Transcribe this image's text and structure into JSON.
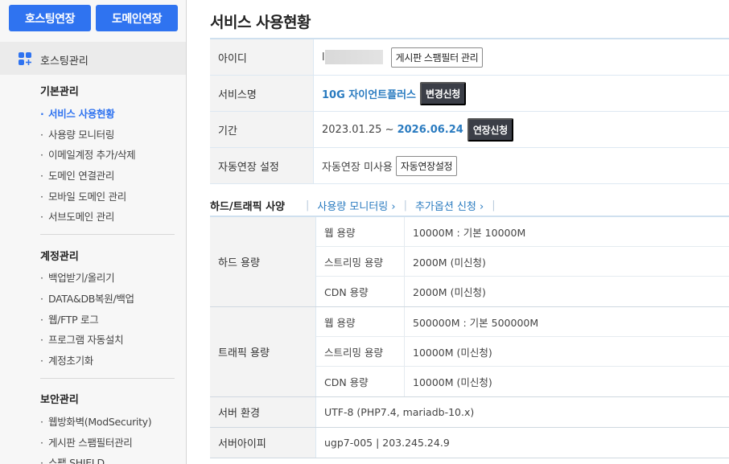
{
  "sidebar": {
    "top_buttons": [
      "호스팅연장",
      "도메인연장"
    ],
    "section_label": "호스팅관리",
    "groups": [
      {
        "title": "기본관리",
        "items": [
          "서비스 사용현황",
          "사용량 모니터링",
          "이메일계정 추가/삭제",
          "도메인 연결관리",
          "모바일 도메인 관리",
          "서브도메인 관리"
        ]
      },
      {
        "title": "계정관리",
        "items": [
          "백업받기/올리기",
          "DATA&DB복원/백업",
          "웹/FTP 로그",
          "프로그램 자동설치",
          "계정초기화"
        ]
      },
      {
        "title": "보안관리",
        "items": [
          "웹방화벽(ModSecurity)",
          "게시판 스팸필터관리",
          "스팸 SHIELD"
        ]
      }
    ],
    "active_item": "서비스 사용현황"
  },
  "main": {
    "title": "서비스 사용현황",
    "info": {
      "id_label": "아이디",
      "id_value": "l",
      "id_button": "게시판 스팸필터 관리",
      "service_label": "서비스명",
      "service_value": "10G 자이언트플러스",
      "service_button": "변경신청",
      "period_label": "기간",
      "period_start": "2023.01.25 ~ ",
      "period_end": "2026.06.24",
      "period_button": "연장신청",
      "auto_label": "자동연장 설정",
      "auto_value": "자동연장 미사용",
      "auto_button": "자동연장설정"
    },
    "spec_header": {
      "title": "하드/트래픽 사양",
      "link1": "사용량 모니터링 ›",
      "link2": "추가옵션 신청 ›"
    },
    "hard": {
      "label": "하드 용량",
      "rows": [
        {
          "k": "웹 용량",
          "v": "10000M : 기본 10000M"
        },
        {
          "k": "스트리밍 용량",
          "v": "2000M (미신청)"
        },
        {
          "k": "CDN 용량",
          "v": "2000M (미신청)"
        }
      ]
    },
    "traffic": {
      "label": "트래픽 용량",
      "rows": [
        {
          "k": "웹 용량",
          "v": "500000M : 기본 500000M"
        },
        {
          "k": "스트리밍 용량",
          "v": "10000M (미신청)"
        },
        {
          "k": "CDN 용량",
          "v": "10000M (미신청)"
        }
      ]
    },
    "server_env": {
      "label": "서버 환경",
      "value": "UTF-8 (PHP7.4, mariadb-10.x)"
    },
    "server_ip": {
      "label": "서버아이피",
      "value": "ugp7-005 | 203.245.24.9"
    }
  },
  "colors": {
    "accent": "#2f73f0",
    "link": "#2a7bc0",
    "dark_button": "#3b3e47"
  }
}
